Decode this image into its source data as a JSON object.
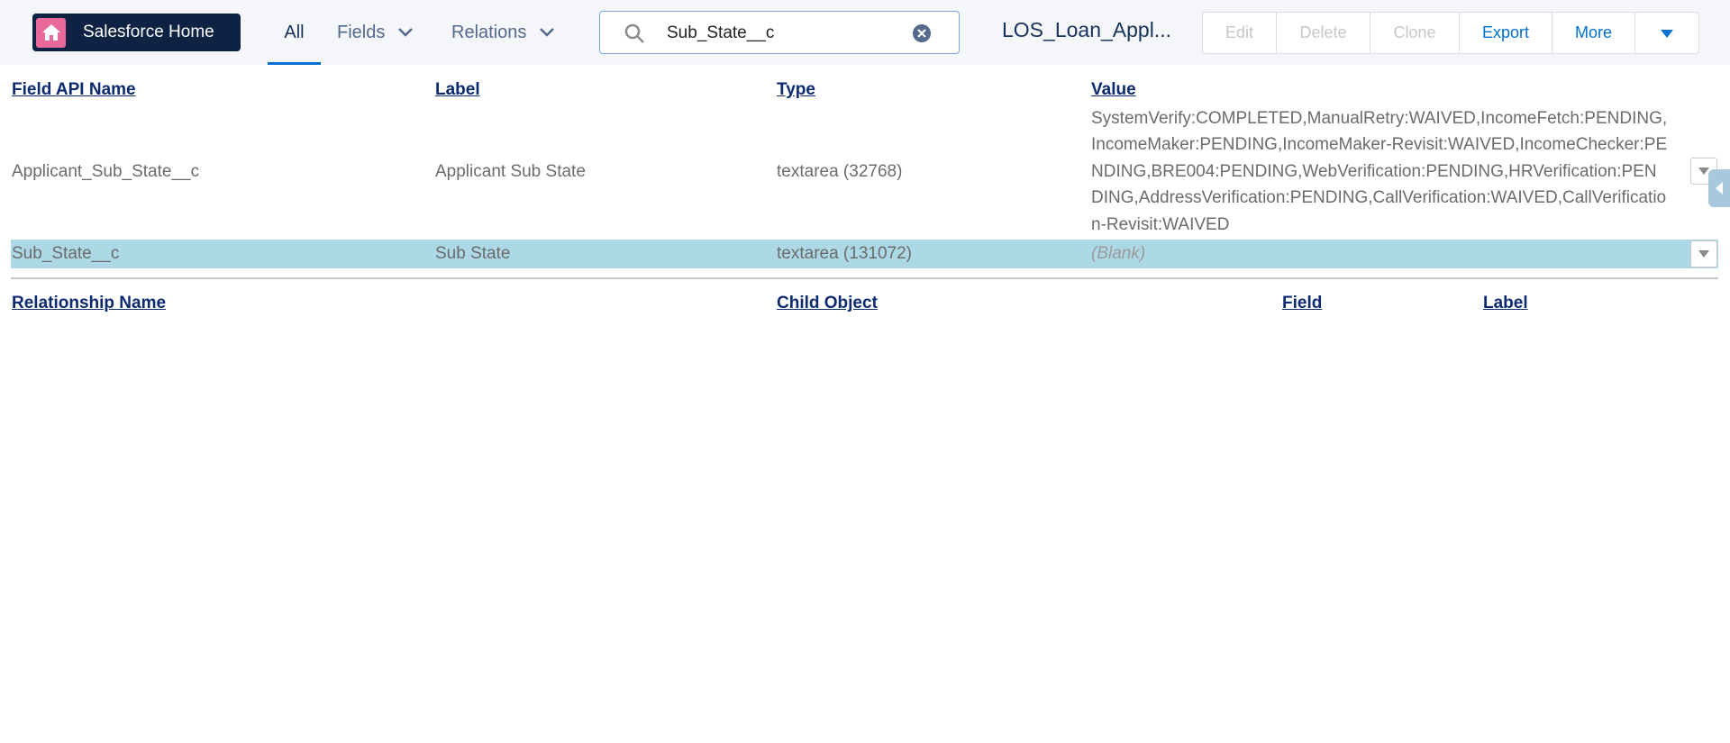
{
  "topbar": {
    "home_label": "Salesforce Home",
    "tabs": [
      {
        "label": "All",
        "active": true
      },
      {
        "label": "Fields",
        "active": false
      },
      {
        "label": "Relations",
        "active": false
      }
    ],
    "search_value": "Sub_State__c",
    "object_title": "LOS_Loan_Appl...",
    "buttons": [
      {
        "label": "Edit",
        "enabled": false
      },
      {
        "label": "Delete",
        "enabled": false
      },
      {
        "label": "Clone",
        "enabled": false
      },
      {
        "label": "Export",
        "enabled": true
      },
      {
        "label": "More",
        "enabled": true
      }
    ]
  },
  "fields_table": {
    "headers": [
      "Field API Name",
      "Label",
      "Type",
      "Value"
    ],
    "rows": [
      {
        "api_name": "Applicant_Sub_State__c",
        "label": "Applicant Sub State",
        "type": "textarea (32768)",
        "value": "SystemVerify:COMPLETED,ManualRetry:WAIVED,IncomeFetch:PENDING,IncomeMaker:PENDING,IncomeMaker-Revisit:WAIVED,IncomeChecker:PENDING,BRE004:PENDING,WebVerification:PENDING,HRVerification:PENDING,AddressVerification:PENDING,CallVerification:WAIVED,CallVerification-Revisit:WAIVED"
      },
      {
        "api_name": "Sub_State__c",
        "label": "Sub State",
        "type": "textarea (131072)",
        "value": "(Blank)",
        "highlighted": true
      }
    ]
  },
  "relations_table": {
    "headers": [
      "Relationship Name",
      "Child Object",
      "Field",
      "Label"
    ]
  },
  "colors": {
    "home_bg": "#0e2344",
    "home_icon_bg": "#e9699a",
    "accent": "#0070d2",
    "row_highlight": "#add8e6",
    "header_link": "#0b2a6f"
  }
}
